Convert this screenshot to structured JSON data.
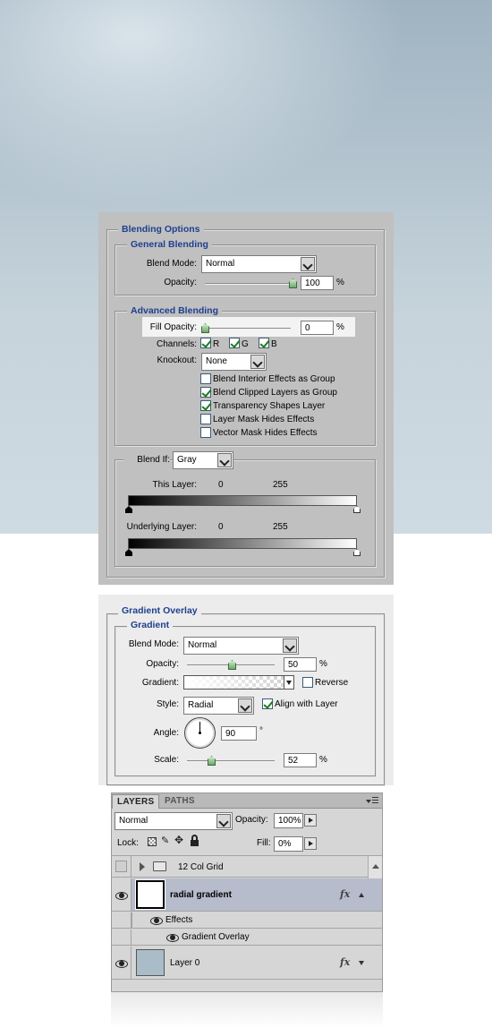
{
  "blending": {
    "title": "Blending Options",
    "general": {
      "title": "General Blending",
      "blend_mode_label": "Blend Mode:",
      "blend_mode": "Normal",
      "opacity_label": "Opacity:",
      "opacity": "100",
      "pct": "%"
    },
    "advanced": {
      "title": "Advanced Blending",
      "fill_opacity_label": "Fill Opacity:",
      "fill_opacity": "0",
      "pct": "%",
      "channels_label": "Channels:",
      "channels": [
        {
          "label": "R",
          "checked": true
        },
        {
          "label": "G",
          "checked": true
        },
        {
          "label": "B",
          "checked": true
        }
      ],
      "knockout_label": "Knockout:",
      "knockout": "None",
      "options": [
        {
          "label": "Blend Interior Effects as Group",
          "checked": false
        },
        {
          "label": "Blend Clipped Layers as Group",
          "checked": true
        },
        {
          "label": "Transparency Shapes Layer",
          "checked": true
        },
        {
          "label": "Layer Mask Hides Effects",
          "checked": false
        },
        {
          "label": "Vector Mask Hides Effects",
          "checked": false
        }
      ]
    },
    "blend_if": {
      "label": "Blend If:",
      "value": "Gray",
      "this_layer_label": "This Layer:",
      "this_layer_min": "0",
      "this_layer_max": "255",
      "underlying_label": "Underlying Layer:",
      "underlying_min": "0",
      "underlying_max": "255"
    }
  },
  "gradient_overlay": {
    "title": "Gradient Overlay",
    "subtitle": "Gradient",
    "blend_mode_label": "Blend Mode:",
    "blend_mode": "Normal",
    "opacity_label": "Opacity:",
    "opacity": "50",
    "pct": "%",
    "gradient_label": "Gradient:",
    "reverse_label": "Reverse",
    "reverse_checked": false,
    "style_label": "Style:",
    "style": "Radial",
    "align_label": "Align with Layer",
    "align_checked": true,
    "angle_label": "Angle:",
    "angle": "90",
    "degree": "°",
    "scale_label": "Scale:",
    "scale": "52",
    "pct2": "%"
  },
  "layers_panel": {
    "tabs": [
      "LAYERS",
      "PATHS"
    ],
    "blend_mode": "Normal",
    "opacity_label": "Opacity:",
    "opacity": "100%",
    "lock_label": "Lock:",
    "fill_label": "Fill:",
    "fill": "0%",
    "layers": {
      "group": {
        "name": "12 Col Grid"
      },
      "radial": {
        "name": "radial gradient",
        "fx": "fx"
      },
      "effects_label": "Effects",
      "effect_item": "Gradient Overlay",
      "layer0": {
        "name": "Layer 0",
        "fx": "fx"
      }
    }
  },
  "colors": {
    "legend_blue": "#1f3f8f",
    "canvas_blue": "#9fb3c1",
    "dialog_gray": "#c0c0c0",
    "check_green": "#1c7a1c",
    "selected_layer": "#b6bccc"
  }
}
